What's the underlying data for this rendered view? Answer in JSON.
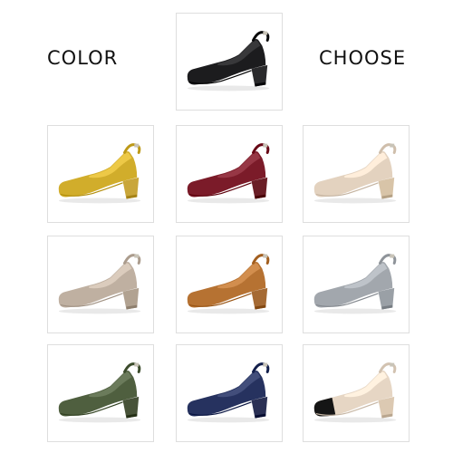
{
  "headings": {
    "left": "COLOR",
    "right": "CHOOSE"
  },
  "shoes": [
    {
      "icon": "shoe-icon",
      "color": "#1c1c1e",
      "heel": "#2a2a2c",
      "toe": null
    },
    {
      "icon": "shoe-icon",
      "color": "#d1ad2b",
      "heel": "#c9a63a",
      "toe": null
    },
    {
      "icon": "shoe-icon",
      "color": "#7b1b29",
      "heel": "#6a1e26",
      "toe": null
    },
    {
      "icon": "shoe-icon",
      "color": "#e3d2bf",
      "heel": "#d8c4a8",
      "toe": null
    },
    {
      "icon": "shoe-icon",
      "color": "#bfb0a1",
      "heel": "#b1a291",
      "toe": null
    },
    {
      "icon": "shoe-icon",
      "color": "#b67232",
      "heel": "#a56a34",
      "toe": null
    },
    {
      "icon": "shoe-icon",
      "color": "#a2a7ad",
      "heel": "#9aa0a6",
      "toe": null
    },
    {
      "icon": "shoe-icon",
      "color": "#4f5f3f",
      "heel": "#475238",
      "toe": null
    },
    {
      "icon": "shoe-icon",
      "color": "#26325f",
      "heel": "#2a3054",
      "toe": null
    },
    {
      "icon": "shoe-icon",
      "color": "#e6d6c4",
      "heel": "#dcc9b2",
      "toe": "#151515"
    }
  ]
}
